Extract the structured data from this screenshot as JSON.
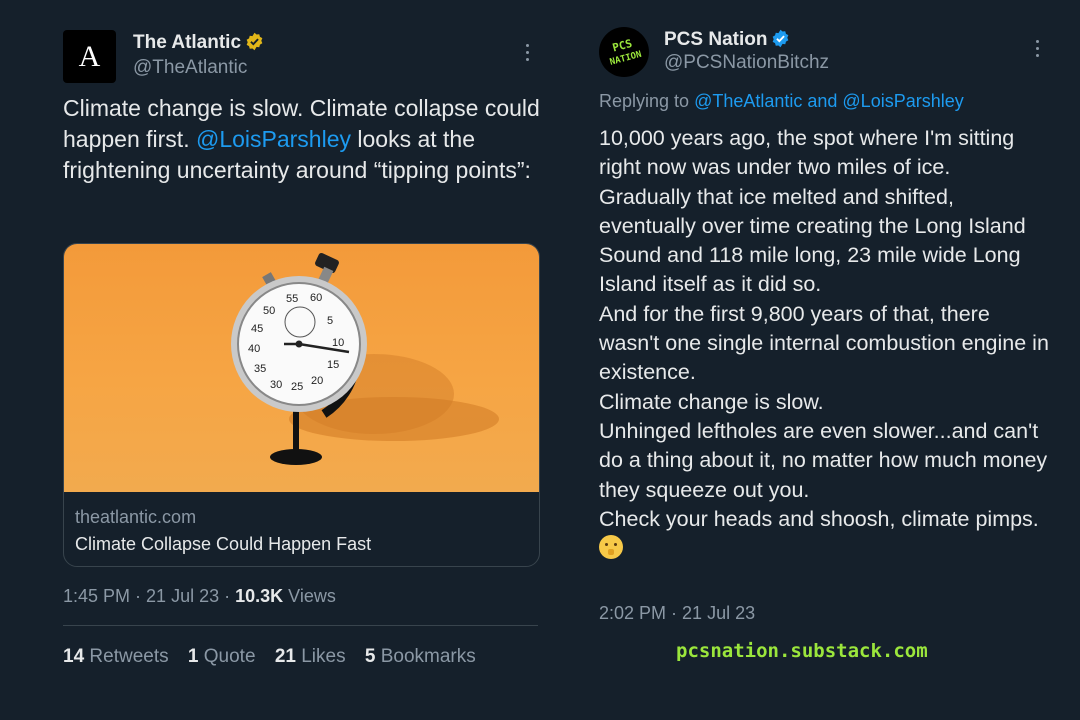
{
  "left_tweet": {
    "avatar_letter": "A",
    "name": "The Atlantic",
    "handle": "@TheAtlantic",
    "verified_badge": "gold-verified-icon",
    "text_before": "Climate change is slow. Climate collapse could happen first. ",
    "mention": "@LoisParshley",
    "text_after": " looks at the frightening uncertainty around “tipping points”:",
    "card": {
      "domain": "theatlantic.com",
      "title": "Climate Collapse Could Happen Fast",
      "image_desc_icon": "stopwatch-icon"
    },
    "time": "1:45 PM",
    "date": "21 Jul 23",
    "views_count": "10.3K",
    "views_label": "Views",
    "stats": {
      "retweets_count": "14",
      "retweets_label": "Retweets",
      "quotes_count": "1",
      "quotes_label": "Quote",
      "likes_count": "21",
      "likes_label": "Likes",
      "bookmarks_count": "5",
      "bookmarks_label": "Bookmarks"
    }
  },
  "right_tweet": {
    "avatar_text": "PCS NATION",
    "name": "PCS Nation",
    "handle": "@PCSNationBitchz",
    "verified_badge": "blue-verified-icon",
    "replying_prefix": "Replying to ",
    "replying_to": "@TheAtlantic and @LoisParshley",
    "lines": [
      "10,000 years ago, the spot where I'm sitting right now was under two miles of ice.",
      "Gradually that ice melted and shifted, eventually over time creating the Long Island Sound and 118 mile long, 23 mile wide Long Island itself as it did so.",
      "And for the first 9,800 years of that, there wasn't one single internal combustion engine in existence.",
      "Climate change is slow.",
      "Unhinged leftholes are even slower...and can't do a thing about it, no matter how much money they squeeze out you.",
      "Check your heads and shoosh, climate pimps."
    ],
    "emoji": "shushing-face-emoji",
    "time": "2:02 PM",
    "date": "21 Jul 23",
    "watermark": "pcsnation.substack.com"
  },
  "colors": {
    "background": "#15202b",
    "text": "#e7e9ea",
    "muted": "#8b98a5",
    "link": "#1d9bf0",
    "watermark": "#9be63c"
  }
}
